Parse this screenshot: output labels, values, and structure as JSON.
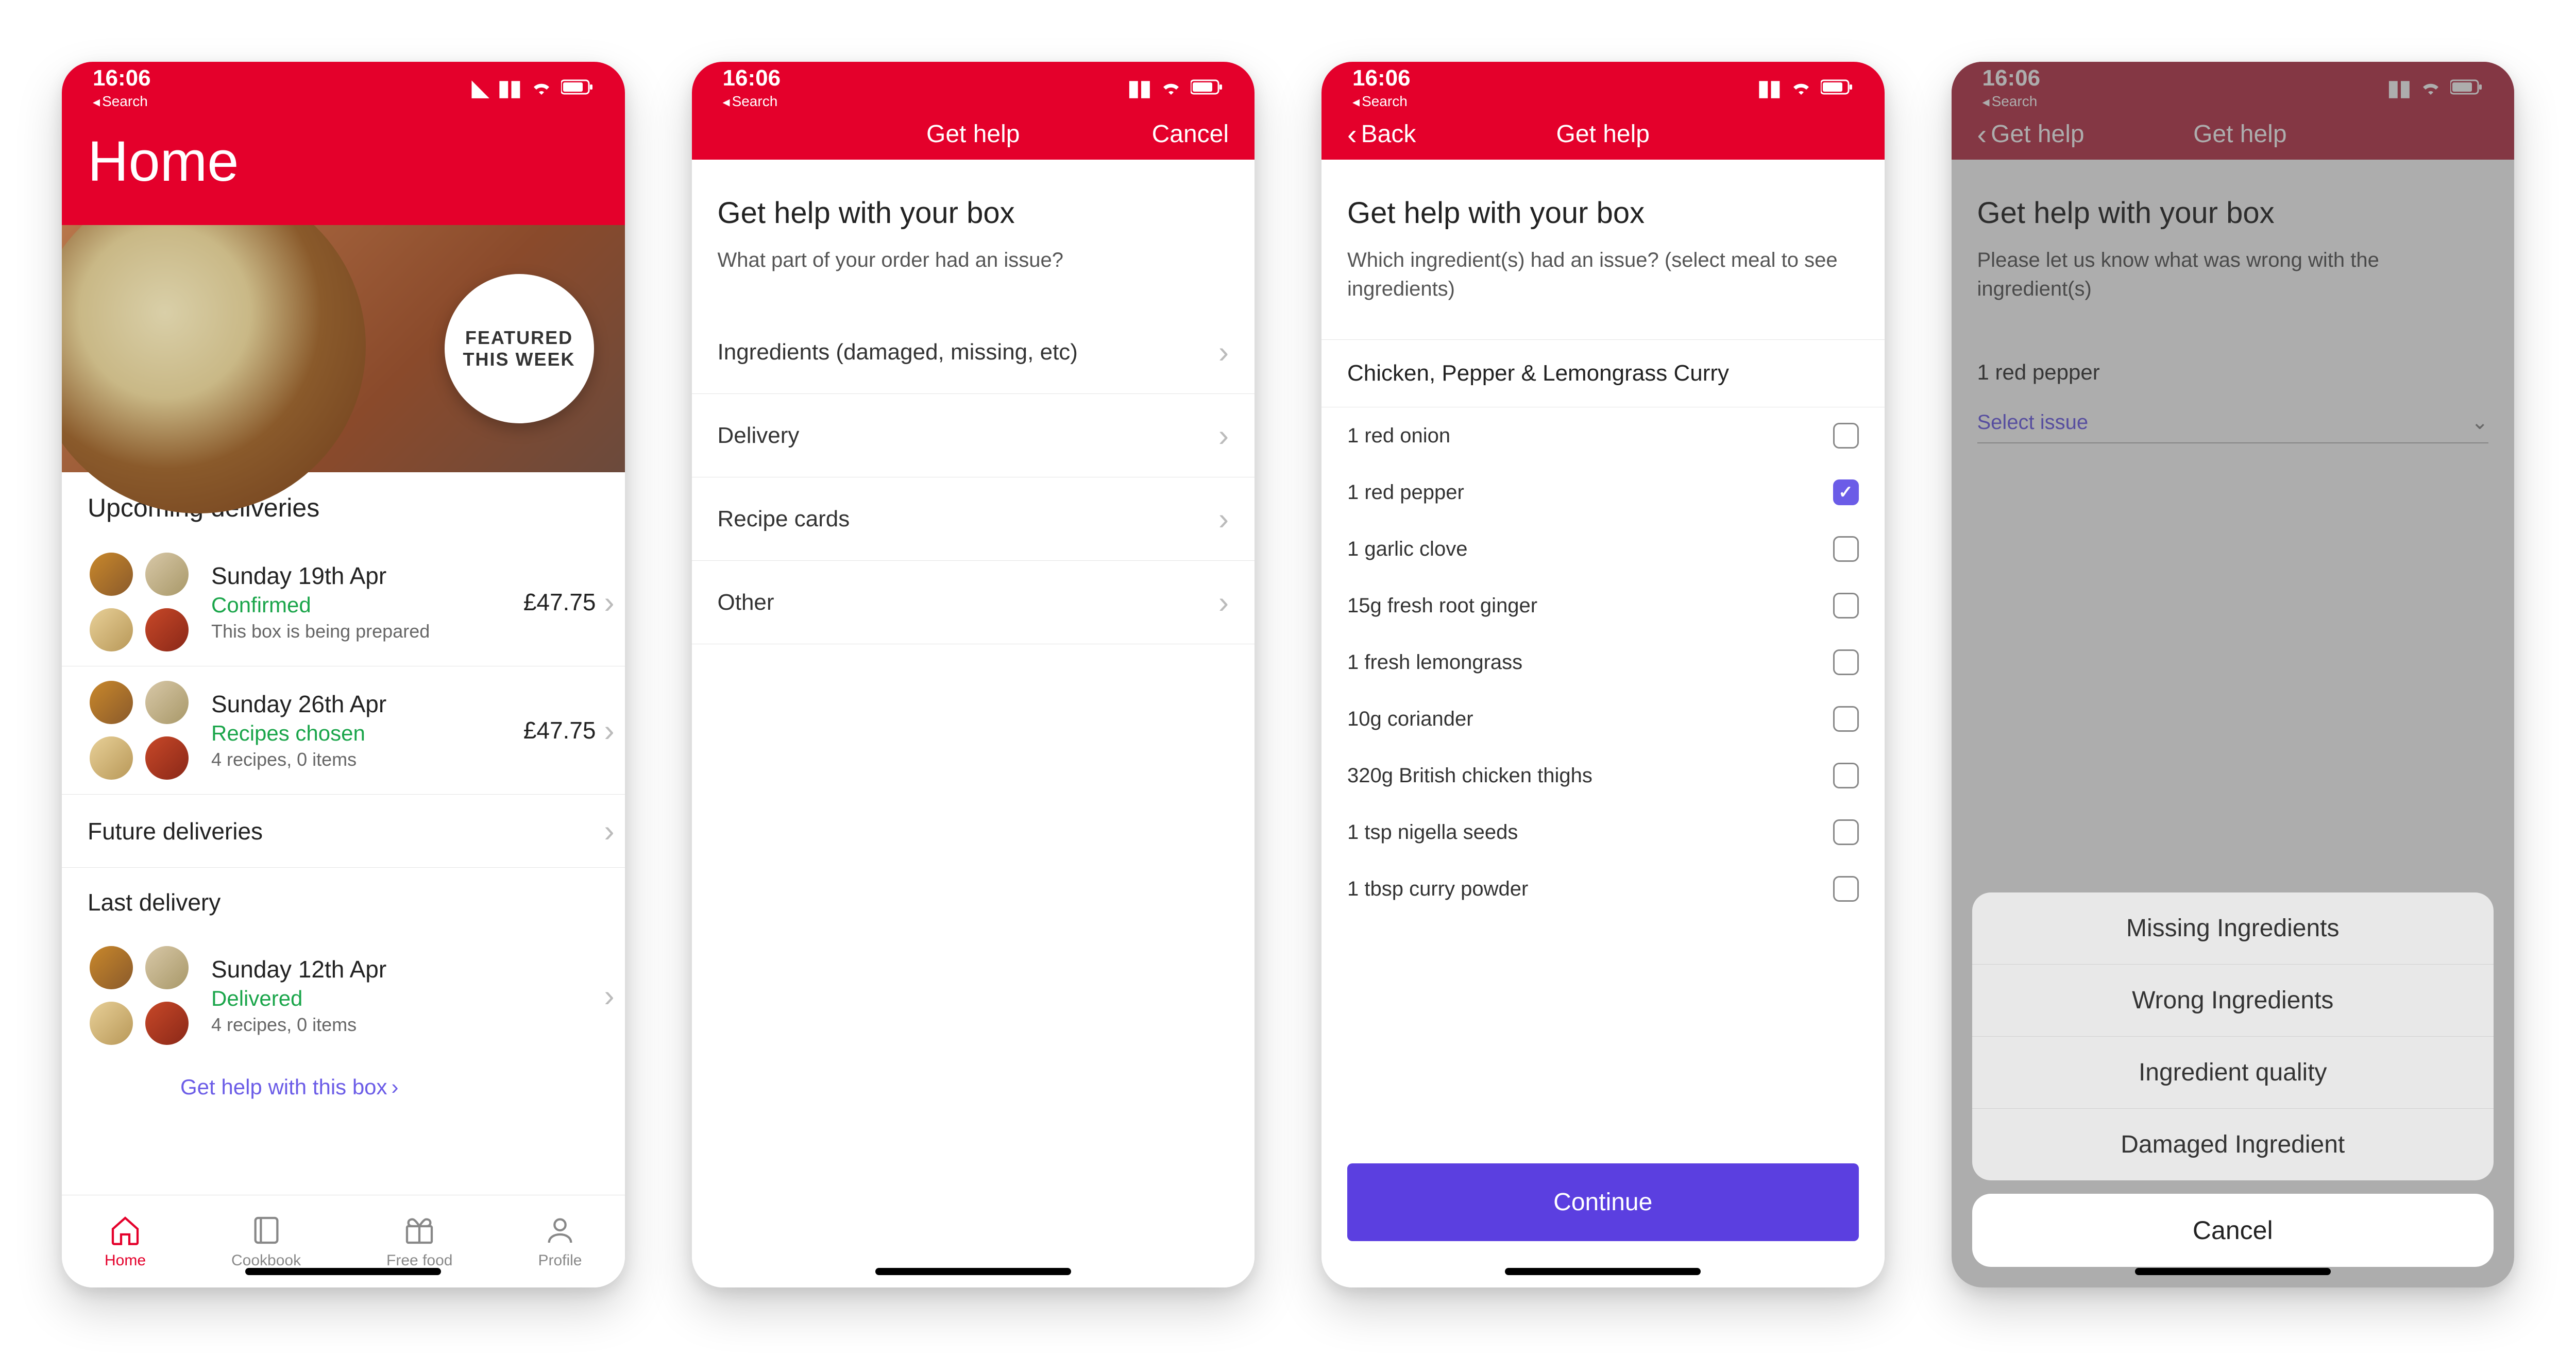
{
  "status": {
    "time": "16:06",
    "back_search": "Search"
  },
  "screen1": {
    "title": "Home",
    "hero_badge_line1": "FEATURED",
    "hero_badge_line2": "THIS WEEK",
    "upcoming_heading": "Upcoming deliveries",
    "deliveries": [
      {
        "date": "Sunday 19th Apr",
        "status": "Confirmed",
        "sub": "This box is being prepared",
        "price": "£47.75"
      },
      {
        "date": "Sunday 26th Apr",
        "status": "Recipes chosen",
        "sub": "4 recipes, 0 items",
        "price": "£47.75"
      }
    ],
    "future": "Future deliveries",
    "last_heading": "Last delivery",
    "last": {
      "date": "Sunday 12th Apr",
      "status": "Delivered",
      "sub": "4 recipes, 0 items"
    },
    "help_link": "Get help with this box",
    "tabs": [
      {
        "label": "Home"
      },
      {
        "label": "Cookbook"
      },
      {
        "label": "Free food"
      },
      {
        "label": "Profile"
      }
    ]
  },
  "screen2": {
    "nav_title": "Get help",
    "nav_cancel": "Cancel",
    "page_title": "Get help with your box",
    "page_sub": "What part of your order had an issue?",
    "options": [
      "Ingredients (damaged, missing, etc)",
      "Delivery",
      "Recipe cards",
      "Other"
    ]
  },
  "screen3": {
    "nav_back": "Back",
    "nav_title": "Get help",
    "page_title": "Get help with your box",
    "page_sub": "Which ingredient(s) had an issue? (select meal to see ingredients)",
    "meal": "Chicken, Pepper & Lemongrass Curry",
    "ingredients": [
      {
        "name": "1 red onion",
        "checked": false
      },
      {
        "name": "1 red pepper",
        "checked": true
      },
      {
        "name": "1 garlic clove",
        "checked": false
      },
      {
        "name": "15g fresh root ginger",
        "checked": false
      },
      {
        "name": "1 fresh lemongrass",
        "checked": false
      },
      {
        "name": "10g coriander",
        "checked": false
      },
      {
        "name": "320g British chicken thighs",
        "checked": false
      },
      {
        "name": "1 tsp nigella seeds",
        "checked": false
      },
      {
        "name": "1 tbsp curry powder",
        "checked": false
      }
    ],
    "continue": "Continue"
  },
  "screen4": {
    "nav_back": "Get help",
    "nav_title": "Get help",
    "page_title": "Get help with your box",
    "page_sub": "Please let us know what was wrong with the ingredient(s)",
    "ingredient": "1 red pepper",
    "select_issue": "Select issue",
    "sheet_options": [
      "Missing Ingredients",
      "Wrong Ingredients",
      "Ingredient quality",
      "Damaged Ingredient"
    ],
    "sheet_cancel": "Cancel"
  }
}
